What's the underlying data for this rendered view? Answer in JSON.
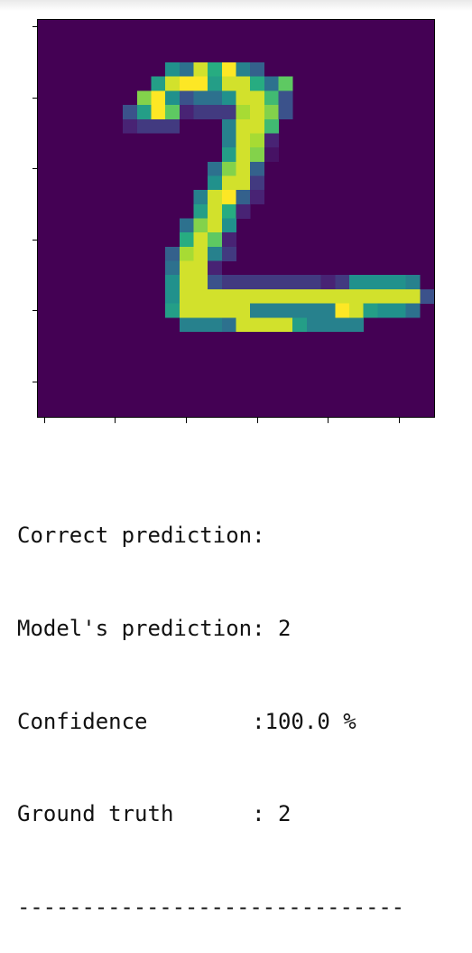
{
  "image": {
    "colormap": "viridis",
    "background_color": "#440154",
    "pixel_rows": [
      "............................",
      "............................",
      "............................",
      ".........LNEJ3MO............",
      "........KEDDKEEJNH..........",
      ".......GDLPNNLEEIP..........",
      "......PKDHRQQQFEGP..........",
      "......RQQQ...MEEI...........",
      ".............MEFR...........",
      ".............KEGS...........",
      "............NGEO............",
      "............LEEQ............",
      "...........MEDOR............",
      "...........KEJR.............",
      "..........NGEL..............",
      "..........JEHR..............",
      ".........OFEMQ..............",
      ".........NEER...............",
      ".........LEEPQQQQQQQRQLLLLM.",
      ".........LEEEEEEEEEEEEEEEEEP.",
      ".........KEEEEEMMMMMMDEKLLN.",
      "..........MMMNEEEEKMMMM.....",
      "............................",
      "............................",
      "............................",
      "............................",
      "............................",
      "............................"
    ]
  },
  "output": {
    "line1": "Correct prediction:",
    "line2": "Model's prediction: 2",
    "line3": "Confidence        :100.0 %",
    "line4": "Ground truth      : 2",
    "line5": "------------------------------"
  }
}
